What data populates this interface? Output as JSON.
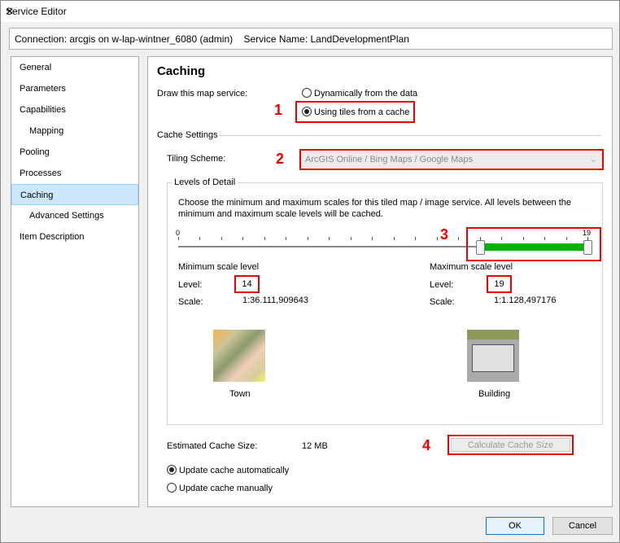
{
  "window": {
    "title": "Service Editor",
    "connection": "Connection: arcgis on w-lap-wintner_6080 (admin)    Service Name: LandDevelopmentPlan"
  },
  "sidebar": {
    "items": [
      {
        "label": "General"
      },
      {
        "label": "Parameters"
      },
      {
        "label": "Capabilities"
      },
      {
        "label": "Mapping"
      },
      {
        "label": "Pooling"
      },
      {
        "label": "Processes"
      },
      {
        "label": "Caching"
      },
      {
        "label": "Advanced Settings"
      },
      {
        "label": "Item Description"
      }
    ]
  },
  "main": {
    "heading": "Caching",
    "draw_label": "Draw this map service:",
    "opt_dynamic": "Dynamically from the data",
    "opt_tiles": "Using tiles from a cache",
    "cache_settings": "Cache Settings",
    "tiling_label": "Tiling Scheme:",
    "tiling_value": "ArcGIS Online / Bing Maps / Google Maps",
    "lod": {
      "legend": "Levels of Detail",
      "description": "Choose the minimum and maximum scales for this tiled map / image service. All levels between the minimum and maximum scale levels will be cached.",
      "slider_min_label": "0",
      "slider_max_label": "19",
      "slider_min": 0,
      "slider_max": 19,
      "selected_min": 14,
      "selected_max": 19,
      "accent": "#00b400",
      "min_title": "Minimum scale level",
      "max_title": "Maximum scale level",
      "level_label": "Level:",
      "scale_label": "Scale:",
      "min_level": "14",
      "max_level": "19",
      "min_scale": "1:36.111,909643",
      "max_scale": "1:1.128,497176",
      "min_image": "Town",
      "max_image": "Building"
    },
    "est_label": "Estimated Cache Size:",
    "est_value": "12 MB",
    "calc_button": "Calculate Cache Size",
    "update_auto": "Update cache automatically",
    "update_manual": "Update cache manually"
  },
  "annotations": [
    "1",
    "2",
    "3",
    "4"
  ],
  "footer": {
    "ok": "OK",
    "cancel": "Cancel"
  }
}
